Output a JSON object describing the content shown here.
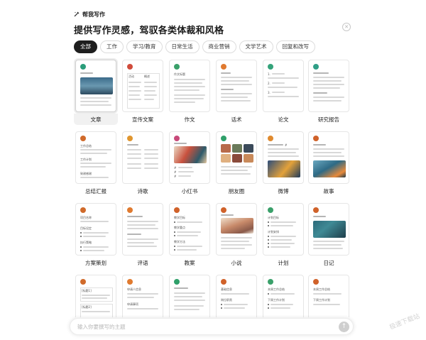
{
  "header": {
    "brand": "帮我写作",
    "title": "提供写作灵感，驾驭各类体裁和风格"
  },
  "tabs": [
    {
      "label": "全部",
      "active": true
    },
    {
      "label": "工作",
      "active": false
    },
    {
      "label": "学习/教育",
      "active": false
    },
    {
      "label": "日常生活",
      "active": false
    },
    {
      "label": "商业营销",
      "active": false
    },
    {
      "label": "文学艺术",
      "active": false
    },
    {
      "label": "回复和改写",
      "active": false
    }
  ],
  "cards": [
    {
      "label": "文章",
      "color": "#2a9d7a"
    },
    {
      "label": "宣传文案",
      "color": "#d04b3b"
    },
    {
      "label": "作文",
      "color": "#3aa06a"
    },
    {
      "label": "话术",
      "color": "#e07a2f"
    },
    {
      "label": "论文",
      "color": "#34a37a"
    },
    {
      "label": "研究报告",
      "color": "#2f9e86"
    },
    {
      "label": "总结汇报",
      "color": "#d06a2a"
    },
    {
      "label": "诗歌",
      "color": "#e0962f"
    },
    {
      "label": "小红书",
      "color": "#c84a7a"
    },
    {
      "label": "朋友圈",
      "color": "#2fa06a"
    },
    {
      "label": "微博",
      "color": "#e08a2f"
    },
    {
      "label": "故事",
      "color": "#d0622a"
    },
    {
      "label": "方案策划",
      "color": "#d06a2a"
    },
    {
      "label": "评语",
      "color": "#e07a2f"
    },
    {
      "label": "教案",
      "color": "#d0622a"
    },
    {
      "label": "小说",
      "color": "#d0622a"
    },
    {
      "label": "计划",
      "color": "#3aa06a"
    },
    {
      "label": "日记",
      "color": "#d0622a"
    },
    {
      "label": "",
      "color": "#d06a2a"
    },
    {
      "label": "",
      "color": "#e07a2f"
    },
    {
      "label": "",
      "color": "#2fa06a"
    },
    {
      "label": "",
      "color": "#d0622a"
    },
    {
      "label": "",
      "color": "#3aa06a"
    },
    {
      "label": "",
      "color": "#d0622a"
    }
  ],
  "card_text": {
    "xuanchuan_col1": "活动",
    "xuanchuan_col2": "概述",
    "zuowen_title": "作文标题",
    "zongjie_1": "工作总结",
    "zongjie_2": "工作计划",
    "zongjie_3": "致谢感谢",
    "fangan_1": "项目名称",
    "fangan_2": "目标设定",
    "fangan_3": "执行策略",
    "jiaoan_1": "教学目标",
    "jiaoan_2": "教学重点",
    "jiaoan_3": "教学方法",
    "jihua_1": "计划目标",
    "jihua_2": "计划安排",
    "row4_a1": "[标题1]",
    "row4_a2": "[标题2]",
    "row4_b1": "申请人信息",
    "row4_b2": "申请事项",
    "row4_d1": "基础信息",
    "row4_d2": "岗位职责",
    "row4_e1": "本周工作总结",
    "row4_e2": "下周工作计划",
    "row4_f1": "本周工作总结",
    "row4_f2": "下周工作计划"
  },
  "input": {
    "placeholder": "输入你要撰写的主题"
  },
  "watermark": "极速下载站",
  "colors": {
    "accent_dark": "#1e1e1e",
    "border": "#e6e6e6"
  }
}
